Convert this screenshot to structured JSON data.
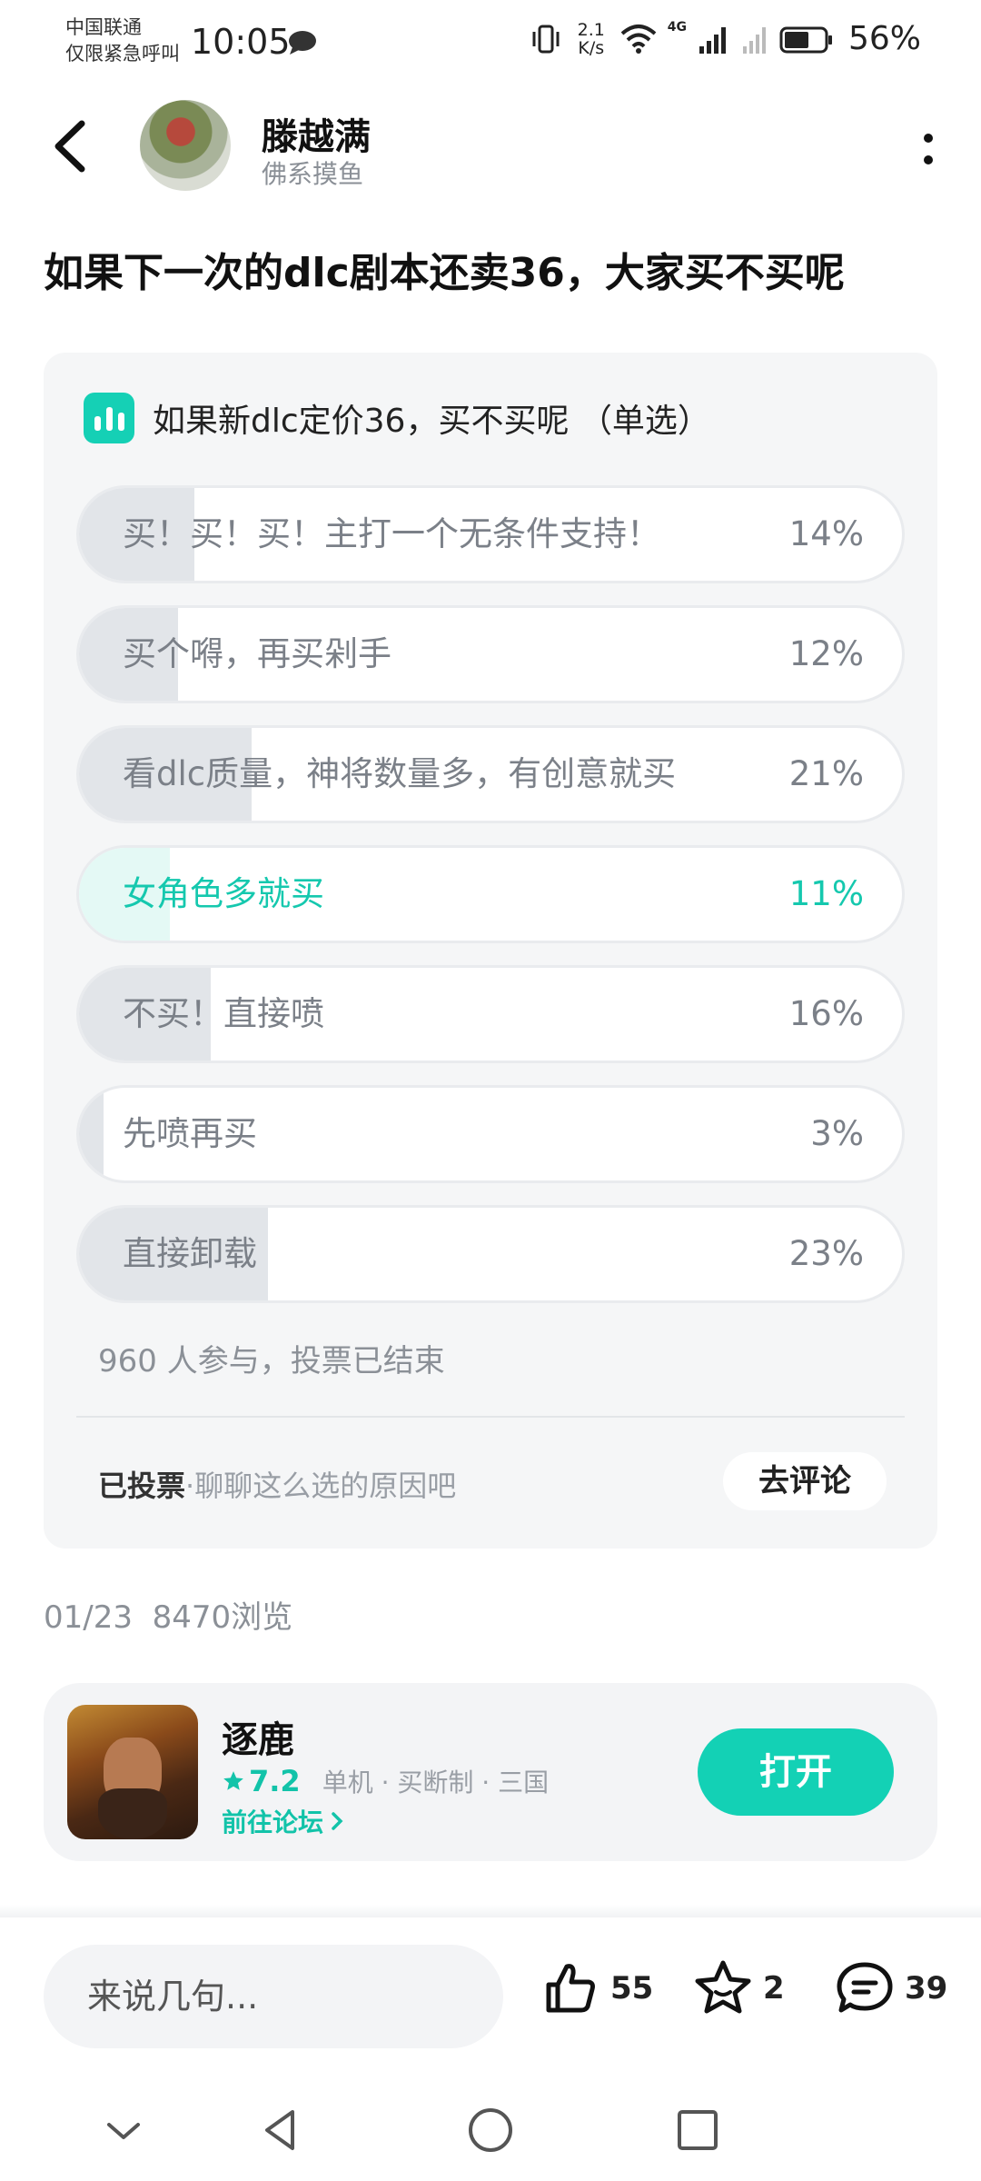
{
  "status": {
    "carrier_line1": "中国联通",
    "carrier_line2": "仅限紧急呼叫",
    "time": "10:05",
    "speed_value": "2.1",
    "speed_unit": "K/s",
    "network": "4G",
    "battery": "56%",
    "icons": [
      "message-bubble-icon",
      "vibrate-icon",
      "wifi-icon",
      "signal-icon",
      "battery-icon"
    ]
  },
  "header": {
    "author_name": "滕越满",
    "author_subtitle": "佛系摸鱼"
  },
  "post": {
    "title": "如果下一次的dlc剧本还卖36，大家买不买呢",
    "date": "01/23",
    "views": "8470浏览"
  },
  "poll": {
    "title": "如果新dlc定价36，买不买呢 （单选）",
    "options": [
      {
        "label": "买！买！买！主打一个无条件支持！",
        "percent": "14%",
        "share": 14,
        "selected": false
      },
      {
        "label": "买个嘚，再买剁手",
        "percent": "12%",
        "share": 12,
        "selected": false
      },
      {
        "label": "看dlc质量，神将数量多，有创意就买",
        "percent": "21%",
        "share": 21,
        "selected": false
      },
      {
        "label": "女角色多就买",
        "percent": "11%",
        "share": 11,
        "selected": true
      },
      {
        "label": "不买！直接喷",
        "percent": "16%",
        "share": 16,
        "selected": false
      },
      {
        "label": "先喷再买",
        "percent": "3%",
        "share": 3,
        "selected": false
      },
      {
        "label": "直接卸载",
        "percent": "23%",
        "share": 23,
        "selected": false
      }
    ],
    "participation": "960 人参与，投票已结束",
    "voted_label": "已投票",
    "voted_hint": "·聊聊这么选的原因吧",
    "comment_button": "去评论"
  },
  "game": {
    "name": "逐鹿",
    "rating": "7.2",
    "tags": "单机 · 买断制 · 三国",
    "forum_link": "前往论坛",
    "open_button": "打开"
  },
  "actions": {
    "comment_placeholder": "来说几句...",
    "likes": "55",
    "favorites": "2",
    "comments": "39"
  },
  "colors": {
    "accent": "#13d1b5",
    "card_bg": "#f5f6f7",
    "muted_text": "#8b9097"
  }
}
